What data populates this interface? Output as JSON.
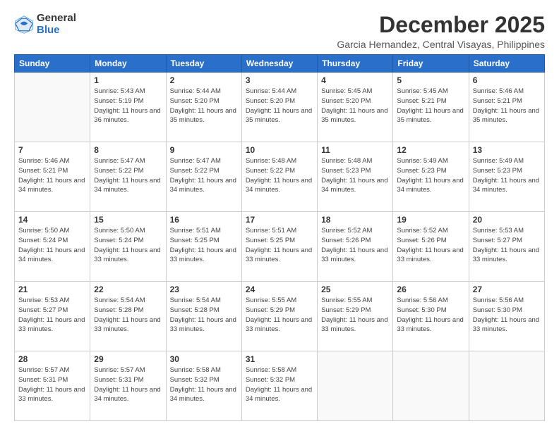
{
  "logo": {
    "general": "General",
    "blue": "Blue"
  },
  "title": "December 2025",
  "subtitle": "Garcia Hernandez, Central Visayas, Philippines",
  "headers": [
    "Sunday",
    "Monday",
    "Tuesday",
    "Wednesday",
    "Thursday",
    "Friday",
    "Saturday"
  ],
  "weeks": [
    [
      {
        "day": "",
        "info": ""
      },
      {
        "day": "1",
        "info": "Sunrise: 5:43 AM\nSunset: 5:19 PM\nDaylight: 11 hours\nand 36 minutes."
      },
      {
        "day": "2",
        "info": "Sunrise: 5:44 AM\nSunset: 5:20 PM\nDaylight: 11 hours\nand 35 minutes."
      },
      {
        "day": "3",
        "info": "Sunrise: 5:44 AM\nSunset: 5:20 PM\nDaylight: 11 hours\nand 35 minutes."
      },
      {
        "day": "4",
        "info": "Sunrise: 5:45 AM\nSunset: 5:20 PM\nDaylight: 11 hours\nand 35 minutes."
      },
      {
        "day": "5",
        "info": "Sunrise: 5:45 AM\nSunset: 5:21 PM\nDaylight: 11 hours\nand 35 minutes."
      },
      {
        "day": "6",
        "info": "Sunrise: 5:46 AM\nSunset: 5:21 PM\nDaylight: 11 hours\nand 35 minutes."
      }
    ],
    [
      {
        "day": "7",
        "info": "Sunrise: 5:46 AM\nSunset: 5:21 PM\nDaylight: 11 hours\nand 34 minutes."
      },
      {
        "day": "8",
        "info": "Sunrise: 5:47 AM\nSunset: 5:22 PM\nDaylight: 11 hours\nand 34 minutes."
      },
      {
        "day": "9",
        "info": "Sunrise: 5:47 AM\nSunset: 5:22 PM\nDaylight: 11 hours\nand 34 minutes."
      },
      {
        "day": "10",
        "info": "Sunrise: 5:48 AM\nSunset: 5:22 PM\nDaylight: 11 hours\nand 34 minutes."
      },
      {
        "day": "11",
        "info": "Sunrise: 5:48 AM\nSunset: 5:23 PM\nDaylight: 11 hours\nand 34 minutes."
      },
      {
        "day": "12",
        "info": "Sunrise: 5:49 AM\nSunset: 5:23 PM\nDaylight: 11 hours\nand 34 minutes."
      },
      {
        "day": "13",
        "info": "Sunrise: 5:49 AM\nSunset: 5:23 PM\nDaylight: 11 hours\nand 34 minutes."
      }
    ],
    [
      {
        "day": "14",
        "info": "Sunrise: 5:50 AM\nSunset: 5:24 PM\nDaylight: 11 hours\nand 34 minutes."
      },
      {
        "day": "15",
        "info": "Sunrise: 5:50 AM\nSunset: 5:24 PM\nDaylight: 11 hours\nand 33 minutes."
      },
      {
        "day": "16",
        "info": "Sunrise: 5:51 AM\nSunset: 5:25 PM\nDaylight: 11 hours\nand 33 minutes."
      },
      {
        "day": "17",
        "info": "Sunrise: 5:51 AM\nSunset: 5:25 PM\nDaylight: 11 hours\nand 33 minutes."
      },
      {
        "day": "18",
        "info": "Sunrise: 5:52 AM\nSunset: 5:26 PM\nDaylight: 11 hours\nand 33 minutes."
      },
      {
        "day": "19",
        "info": "Sunrise: 5:52 AM\nSunset: 5:26 PM\nDaylight: 11 hours\nand 33 minutes."
      },
      {
        "day": "20",
        "info": "Sunrise: 5:53 AM\nSunset: 5:27 PM\nDaylight: 11 hours\nand 33 minutes."
      }
    ],
    [
      {
        "day": "21",
        "info": "Sunrise: 5:53 AM\nSunset: 5:27 PM\nDaylight: 11 hours\nand 33 minutes."
      },
      {
        "day": "22",
        "info": "Sunrise: 5:54 AM\nSunset: 5:28 PM\nDaylight: 11 hours\nand 33 minutes."
      },
      {
        "day": "23",
        "info": "Sunrise: 5:54 AM\nSunset: 5:28 PM\nDaylight: 11 hours\nand 33 minutes."
      },
      {
        "day": "24",
        "info": "Sunrise: 5:55 AM\nSunset: 5:29 PM\nDaylight: 11 hours\nand 33 minutes."
      },
      {
        "day": "25",
        "info": "Sunrise: 5:55 AM\nSunset: 5:29 PM\nDaylight: 11 hours\nand 33 minutes."
      },
      {
        "day": "26",
        "info": "Sunrise: 5:56 AM\nSunset: 5:30 PM\nDaylight: 11 hours\nand 33 minutes."
      },
      {
        "day": "27",
        "info": "Sunrise: 5:56 AM\nSunset: 5:30 PM\nDaylight: 11 hours\nand 33 minutes."
      }
    ],
    [
      {
        "day": "28",
        "info": "Sunrise: 5:57 AM\nSunset: 5:31 PM\nDaylight: 11 hours\nand 33 minutes."
      },
      {
        "day": "29",
        "info": "Sunrise: 5:57 AM\nSunset: 5:31 PM\nDaylight: 11 hours\nand 34 minutes."
      },
      {
        "day": "30",
        "info": "Sunrise: 5:58 AM\nSunset: 5:32 PM\nDaylight: 11 hours\nand 34 minutes."
      },
      {
        "day": "31",
        "info": "Sunrise: 5:58 AM\nSunset: 5:32 PM\nDaylight: 11 hours\nand 34 minutes."
      },
      {
        "day": "",
        "info": ""
      },
      {
        "day": "",
        "info": ""
      },
      {
        "day": "",
        "info": ""
      }
    ]
  ]
}
